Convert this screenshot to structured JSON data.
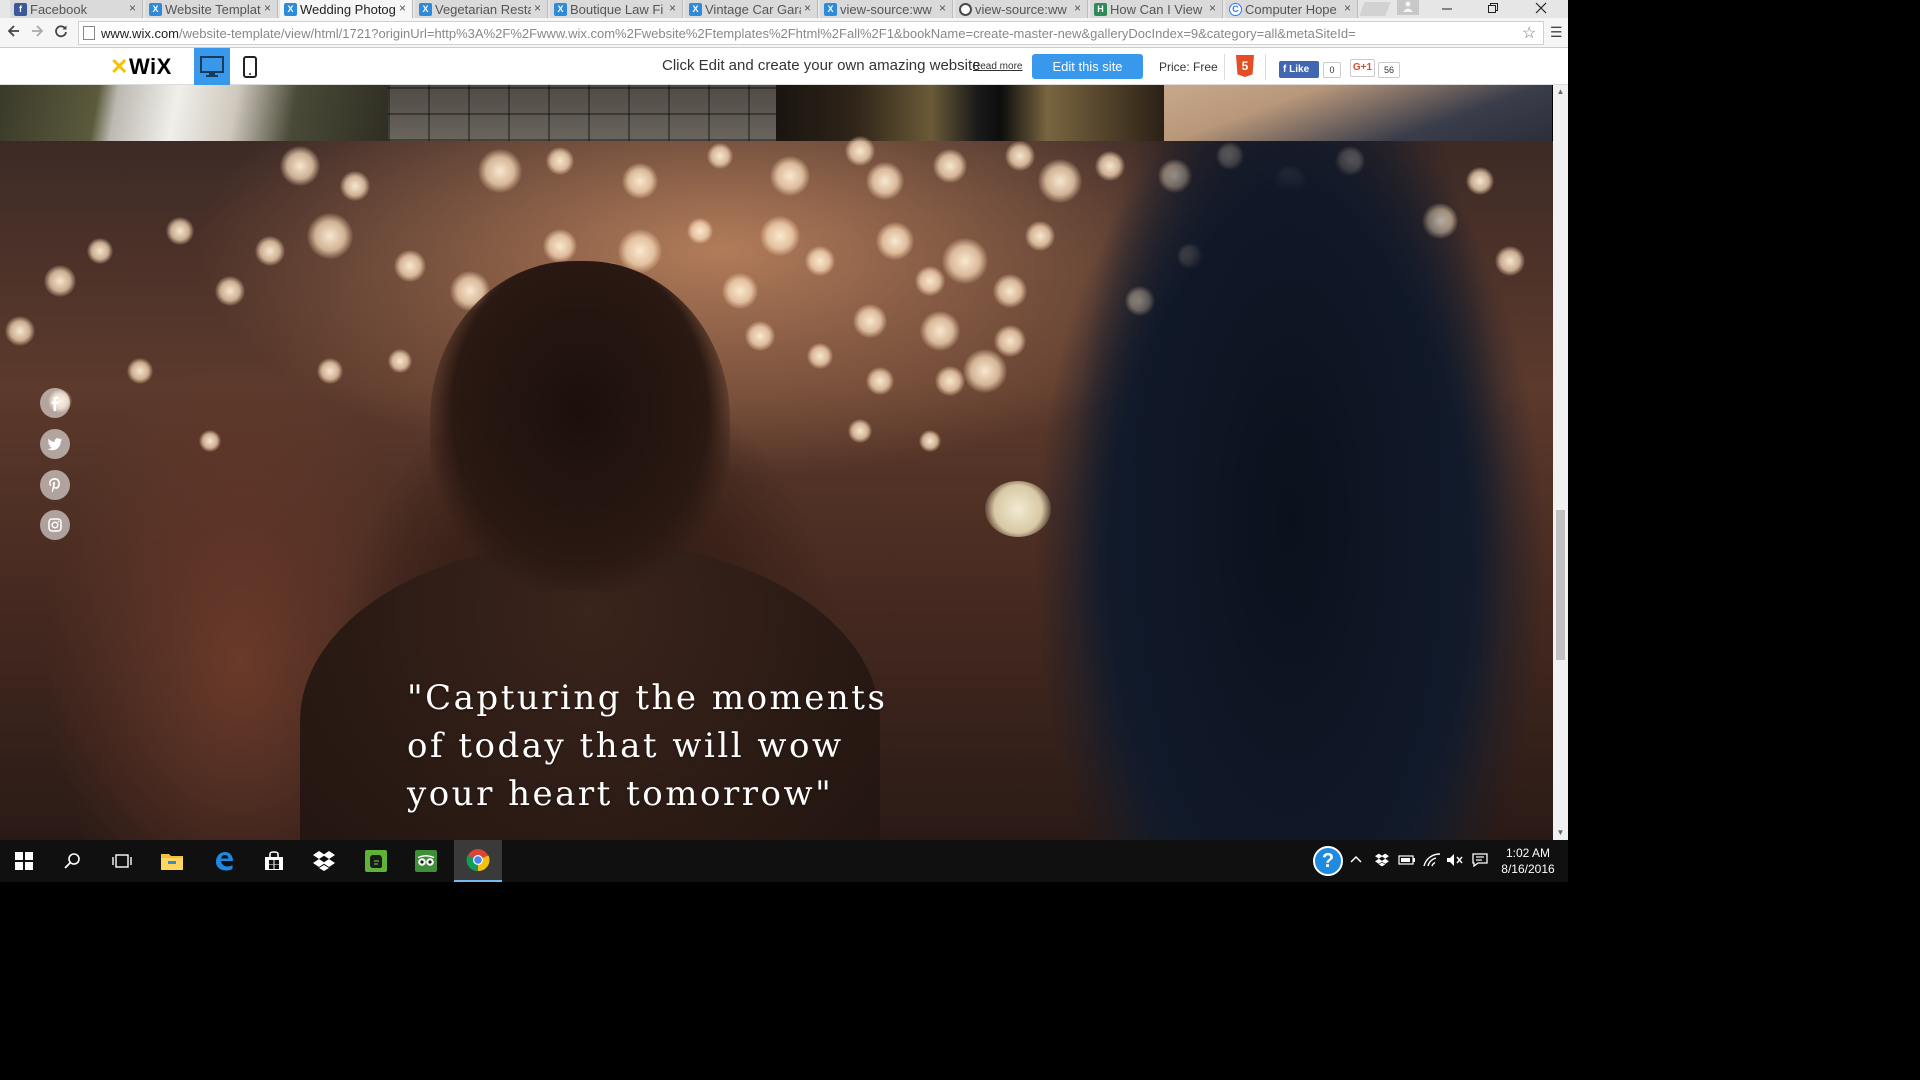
{
  "browser": {
    "tabs": [
      {
        "label": "Facebook",
        "icon": "facebook-icon",
        "active": false
      },
      {
        "label": "Website Templat",
        "icon": "wix-icon",
        "active": false
      },
      {
        "label": "Wedding Photog",
        "icon": "wix-icon",
        "active": true
      },
      {
        "label": "Vegetarian Resta",
        "icon": "wix-icon",
        "active": false
      },
      {
        "label": "Boutique Law Fi",
        "icon": "wix-icon",
        "active": false
      },
      {
        "label": "Vintage Car Gara",
        "icon": "wix-icon",
        "active": false
      },
      {
        "label": "view-source:ww",
        "icon": "wix-icon",
        "active": false
      },
      {
        "label": "view-source:ww",
        "icon": "chrome-page-icon",
        "active": false
      },
      {
        "label": "How Can I View",
        "icon": "hciv-icon",
        "active": false
      },
      {
        "label": "Computer Hope",
        "icon": "computer-hope-icon",
        "active": false
      }
    ],
    "tab_close_glyph": "×",
    "url_host": "www.wix.com",
    "url_rest": "/website-template/view/html/1721?originUrl=http%3A%2F%2Fwww.wix.com%2Fwebsite%2Ftemplates%2Fhtml%2Fall%2F1&bookName=create-master-new&galleryDocIndex=9&category=all&metaSiteId="
  },
  "wixbar": {
    "logo": "WiX",
    "promo_text": "Click Edit and create your own amazing website",
    "read_more": "Read more",
    "edit_button": "Edit this site",
    "price": "Price: Free",
    "html5_badge": "5",
    "fb_like": "Like",
    "fb_like_count": "0",
    "gplus_label": "G+1",
    "gplus_count": "56"
  },
  "hero": {
    "quote_lines": [
      "\"Capturing the moments",
      "of today that will wow",
      "your heart tomorrow\""
    ],
    "social_icons": [
      "facebook-icon",
      "twitter-icon",
      "pinterest-icon",
      "instagram-icon"
    ]
  },
  "taskbar": {
    "clock_time": "1:02 AM",
    "clock_date": "8/16/2016",
    "apps": [
      "start-icon",
      "search-icon",
      "task-view-icon",
      "file-explorer-icon",
      "edge-icon",
      "store-icon",
      "dropbox-icon",
      "evernote-icon",
      "tripadvisor-icon",
      "chrome-icon"
    ]
  },
  "colors": {
    "wix_blue": "#3899ec",
    "taskbar_bg": "#101010",
    "quote_text": "#ffffff"
  }
}
